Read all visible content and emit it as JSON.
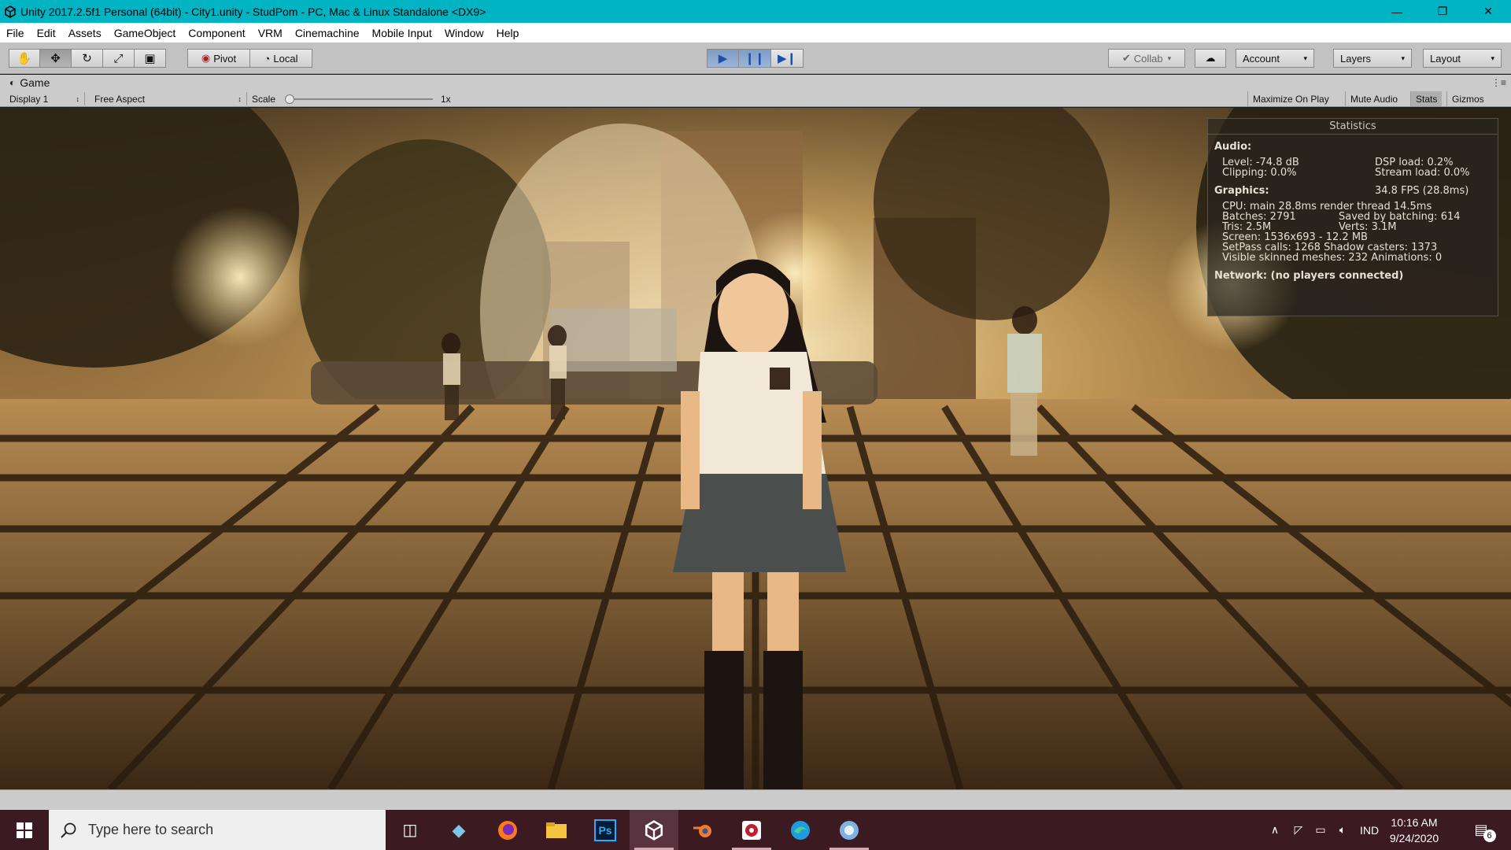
{
  "window": {
    "title": "Unity 2017.2.5f1 Personal (64bit) - City1.unity - StudPom - PC, Mac & Linux Standalone <DX9>",
    "icon": "unity-logo-icon",
    "controls": [
      "minimize-icon",
      "restore-icon",
      "close-icon"
    ]
  },
  "menu": [
    "File",
    "Edit",
    "Assets",
    "GameObject",
    "Component",
    "VRM",
    "Cinemachine",
    "Mobile Input",
    "Window",
    "Help"
  ],
  "toolbar": {
    "tools": [
      "hand-icon",
      "move-icon",
      "rotate-icon",
      "scale-icon",
      "rect-tool-icon"
    ],
    "pivot_label": "Pivot",
    "local_label": "Local",
    "playback": [
      "play-icon",
      "pause-icon",
      "step-icon"
    ],
    "collab_label": "Collab",
    "account_label": "Account",
    "layers_label": "Layers",
    "layout_label": "Layout"
  },
  "game_view": {
    "tab_label": "Game",
    "display_label": "Display 1",
    "aspect_label": "Free Aspect",
    "scale_label": "Scale",
    "scale_value": "1x",
    "toggles": [
      "Maximize On Play",
      "Mute Audio",
      "Stats",
      "Gizmos"
    ]
  },
  "statistics": {
    "title": "Statistics",
    "audio_heading": "Audio:",
    "level": "Level: -74.8 dB",
    "dsp_load": "DSP load: 0.2%",
    "clipping": "Clipping: 0.0%",
    "stream_load": "Stream load: 0.0%",
    "graphics_heading": "Graphics:",
    "fps": "34.8 FPS (28.8ms)",
    "cpu": "CPU: main 28.8ms  render thread 14.5ms",
    "batches": "Batches: 2791",
    "saved_batching": "Saved by batching: 614",
    "tris": "Tris: 2.5M",
    "verts": "Verts: 3.1M",
    "screen": "Screen: 1536x693 - 12.2 MB",
    "setpass": "SetPass calls: 1268  Shadow casters: 1373",
    "skinned": "Visible skinned meshes: 232  Animations: 0",
    "network": "Network: (no players connected)"
  },
  "taskbar": {
    "search_placeholder": "Type here to search",
    "apps": [
      "task-view-icon",
      "app-launcher-icon",
      "firefox-icon",
      "file-explorer-icon",
      "photoshop-icon",
      "unity-icon",
      "blender-icon",
      "recording-app-icon",
      "edge-icon",
      "vroid-icon"
    ],
    "photoshop_label": "Ps",
    "language": "IND",
    "time": "10:16 AM",
    "date": "9/24/2020",
    "notification_count": "6"
  }
}
